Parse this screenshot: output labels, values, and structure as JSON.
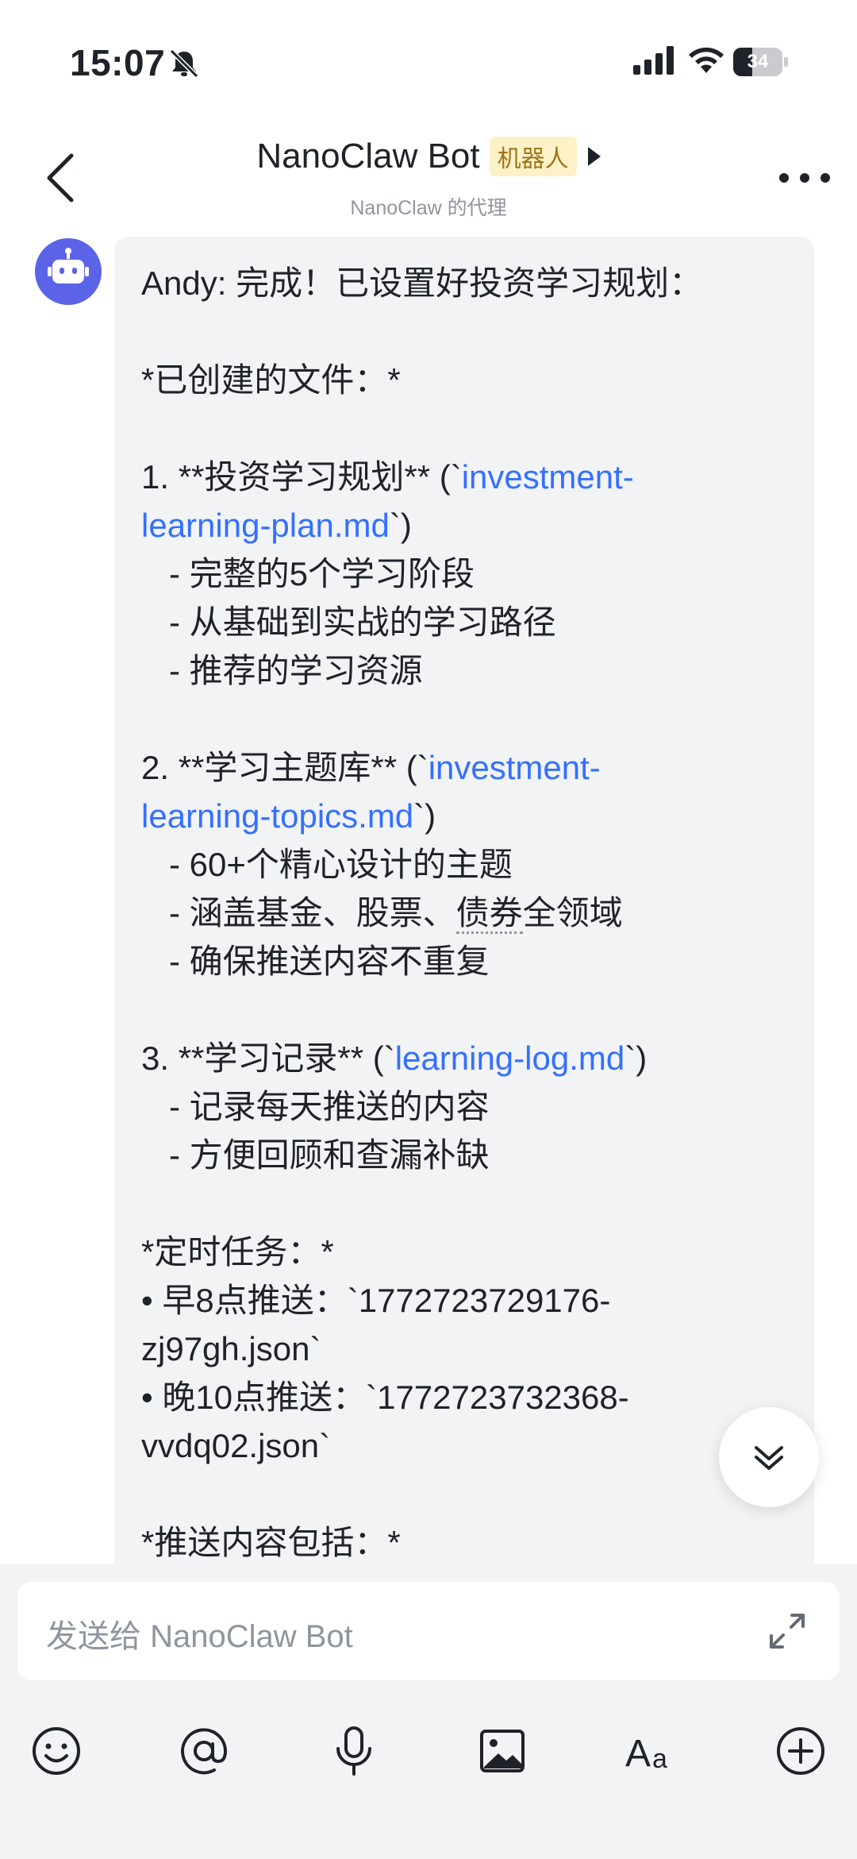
{
  "status_bar": {
    "time": "15:07",
    "battery": "34"
  },
  "header": {
    "title": "NanoClaw Bot",
    "badge": "机器人",
    "subtitle": "NanoClaw 的代理"
  },
  "message": {
    "sender": "Andy",
    "line_01": "Andy: 完成！已设置好投资学习规划：",
    "line_03": "*已创建的文件：*",
    "line_05a": "1. **投资学习规划** (`",
    "line_05b": "investment-",
    "line_06a": "learning-plan.md",
    "line_06b": "`)",
    "line_07": "   - 完整的5个学习阶段",
    "line_08": "   - 从基础到实战的学习路径",
    "line_09": "   - 推荐的学习资源",
    "line_11a": "2. **学习主题库** (`",
    "line_11b": "investment-",
    "line_12a": "learning-topics.md",
    "line_12b": "`)",
    "line_13": "   - 60+个精心设计的主题",
    "line_14a": "   - 涵盖基金、股票、",
    "line_14b": "债券",
    "line_14c": "全领域",
    "line_15": "   - 确保推送内容不重复",
    "line_17a": "3. **学习记录** (`",
    "line_17b": "learning-log.md",
    "line_17c": "`)",
    "line_18": "   - 记录每天推送的内容",
    "line_19": "   - 方便回顾和查漏补缺",
    "line_21": "*定时任务：*",
    "line_22": "• 早8点推送：`1772723729176-",
    "line_23": "zj97gh.json`",
    "line_24": "• 晚10点推送：`1772723732368-",
    "line_25": "vvdq02.json`",
    "line_27": "*推送内容包括：*"
  },
  "composer": {
    "placeholder": "发送给 NanoClaw Bot",
    "tools": [
      "emoji-icon",
      "mention-icon",
      "microphone-icon",
      "image-icon",
      "font-icon",
      "plus-icon"
    ]
  },
  "colors": {
    "link": "#3370ff",
    "badge_bg": "#fdf2c7",
    "badge_text": "#a0751a",
    "avatar": "#5b64e6"
  }
}
